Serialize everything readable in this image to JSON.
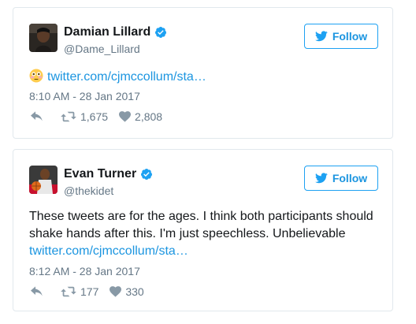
{
  "tweets": [
    {
      "name": "Damian Lillard",
      "handle": "@Dame_Lillard",
      "follow_label": "Follow",
      "emoji": "flushed-face",
      "text": "",
      "link": "twitter.com/cjmccollum/sta…",
      "timestamp": "8:10 AM - 28 Jan 2017",
      "retweets": "1,675",
      "likes": "2,808"
    },
    {
      "name": "Evan Turner",
      "handle": "@thekidet",
      "follow_label": "Follow",
      "text": "These tweets are for the ages. I think both participants should shake hands after this. I'm just speechless. Unbelievable",
      "link": "twitter.com/cjmccollum/sta…",
      "timestamp": "8:12 AM - 28 Jan 2017",
      "retweets": "177",
      "likes": "330"
    }
  ],
  "colors": {
    "brand_blue": "#1da1f2",
    "link_blue": "#1b95e0",
    "muted_gray": "#657786",
    "icon_gray": "#8899a6",
    "border": "#e1e8ed"
  },
  "icons": [
    "verified-badge-icon",
    "twitter-bird-icon",
    "reply-icon",
    "retweet-icon",
    "heart-icon",
    "flushed-face-emoji-icon"
  ]
}
